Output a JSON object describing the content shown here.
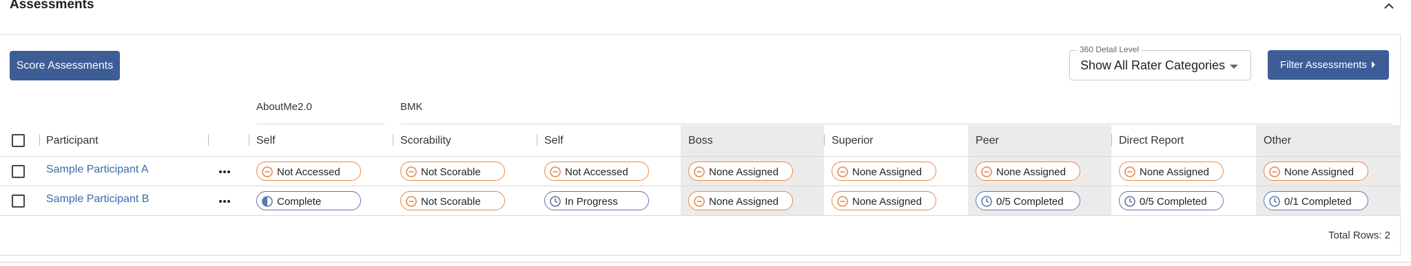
{
  "section": {
    "title": "Assessments"
  },
  "toolbar": {
    "score_button": "Score Assessments",
    "detail_level_label": "360 Detail Level",
    "detail_level_value": "Show All Rater Categories",
    "filter_button": "Filter Assessments"
  },
  "groups": [
    "AboutMe2.0",
    "BMK"
  ],
  "columns": [
    "Participant",
    "Self",
    "Scorability",
    "Self",
    "Boss",
    "Superior",
    "Peer",
    "Direct Report",
    "Other"
  ],
  "rows": [
    {
      "participant": "Sample Participant A",
      "cells": [
        {
          "text": "Not Accessed",
          "status": "warn",
          "icon": "minus-circle-icon"
        },
        {
          "text": "Not Scorable",
          "status": "warn",
          "icon": "minus-circle-icon"
        },
        {
          "text": "Not Accessed",
          "status": "warn",
          "icon": "minus-circle-icon"
        },
        {
          "text": "None Assigned",
          "status": "warn",
          "icon": "minus-circle-icon"
        },
        {
          "text": "None Assigned",
          "status": "warn",
          "icon": "minus-circle-icon"
        },
        {
          "text": "None Assigned",
          "status": "warn",
          "icon": "minus-circle-icon"
        },
        {
          "text": "None Assigned",
          "status": "warn",
          "icon": "minus-circle-icon"
        },
        {
          "text": "None Assigned",
          "status": "warn",
          "icon": "minus-circle-icon"
        }
      ]
    },
    {
      "participant": "Sample Participant B",
      "cells": [
        {
          "text": "Complete",
          "status": "info",
          "icon": "half-circle-icon"
        },
        {
          "text": "Not Scorable",
          "status": "warn",
          "icon": "minus-circle-icon"
        },
        {
          "text": "In Progress",
          "status": "info",
          "icon": "clock-icon"
        },
        {
          "text": "None Assigned",
          "status": "warn",
          "icon": "minus-circle-icon"
        },
        {
          "text": "None Assigned",
          "status": "warn",
          "icon": "minus-circle-icon"
        },
        {
          "text": "0/5 Completed",
          "status": "info",
          "icon": "clock-icon"
        },
        {
          "text": "0/5 Completed",
          "status": "info",
          "icon": "clock-icon"
        },
        {
          "text": "0/1 Completed",
          "status": "info",
          "icon": "clock-icon"
        }
      ]
    }
  ],
  "footer": {
    "total_rows": "Total Rows: 2"
  },
  "colors": {
    "primary": "#3c5d96",
    "link": "#3c6aa8",
    "warn": "#e8874a",
    "info": "#5b76a8",
    "grey_column": "#ebebeb"
  }
}
